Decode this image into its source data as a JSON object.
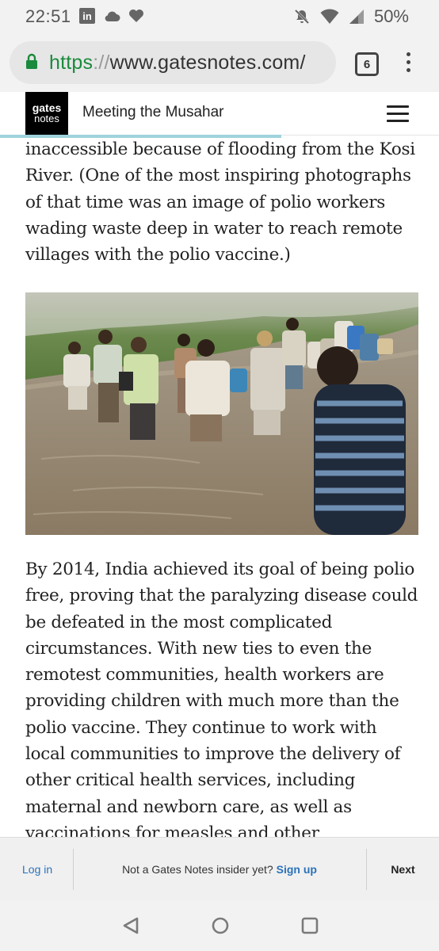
{
  "status_bar": {
    "time": "22:51",
    "battery": "50%",
    "linkedin_glyph": "in"
  },
  "browser": {
    "url_scheme": "https",
    "url_sep": "://",
    "url_host": "www.gatesnotes.com/",
    "tab_count": "6"
  },
  "site": {
    "logo_top": "gates",
    "logo_bottom": "notes",
    "article_title": "Meeting the Musahar"
  },
  "article": {
    "paragraph_1": "inaccessible because of flooding from the Kosi River. (One of the most inspiring photographs of that time was an image of polio workers wading waste deep in water to reach remote villages with the polio vaccine.)",
    "paragraph_2": "By 2014, India achieved its goal of being polio free, proving that the paralyzing disease could be defeated in the most complicated circumstances. With new ties to even the remotest communities, health workers are providing children with much more than the polio vaccine. They continue to work with local communities to improve the delivery of other critical health services, including maternal and newborn care, as well as vaccinations for measles and other preventable diseases."
  },
  "signup_bar": {
    "login": "Log in",
    "prompt": "Not a Gates Notes insider yet?",
    "signup": "Sign up",
    "next": "Next"
  },
  "colors": {
    "link": "#2b72b8",
    "secure": "#1a8a3c",
    "progress": "#9fd3dd"
  },
  "reading_progress": 0.64,
  "icons": [
    "linkedin-icon",
    "cloud-icon",
    "heart-icon",
    "dnd-off-icon",
    "wifi-icon",
    "signal-icon",
    "lock-icon",
    "tabs-icon",
    "overflow-menu-icon",
    "hamburger-menu-icon",
    "back-icon",
    "home-icon",
    "recents-icon"
  ]
}
